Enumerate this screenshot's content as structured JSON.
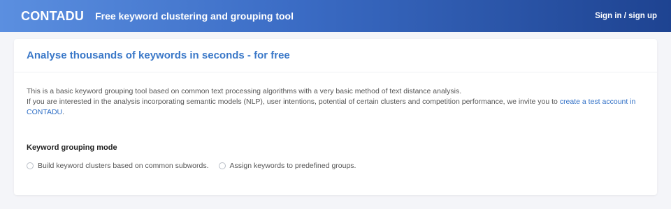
{
  "header": {
    "logo": "CONTADU",
    "tagline": "Free keyword clustering and grouping tool",
    "signin": "Sign in / sign up"
  },
  "card": {
    "title": "Analyse thousands of keywords in seconds - for free",
    "desc_line1": "This is a basic keyword grouping tool based on common text processing algorithms with a very basic method of text distance analysis.",
    "desc_line2": "If you are interested in the analysis incorporating semantic models (NLP), user intentions, potential of certain clusters and competition performance, we invite you to ",
    "desc_link": "create a test account in CONTADU",
    "desc_end": ".",
    "mode_title": "Keyword grouping mode",
    "options": [
      {
        "label": "Build keyword clusters based on common subwords."
      },
      {
        "label": "Assign keywords to predefined groups."
      }
    ]
  },
  "colors": {
    "accent": "#3a78c8",
    "header_gradient_start": "#5b8fe0",
    "header_gradient_end": "#1e4391"
  }
}
